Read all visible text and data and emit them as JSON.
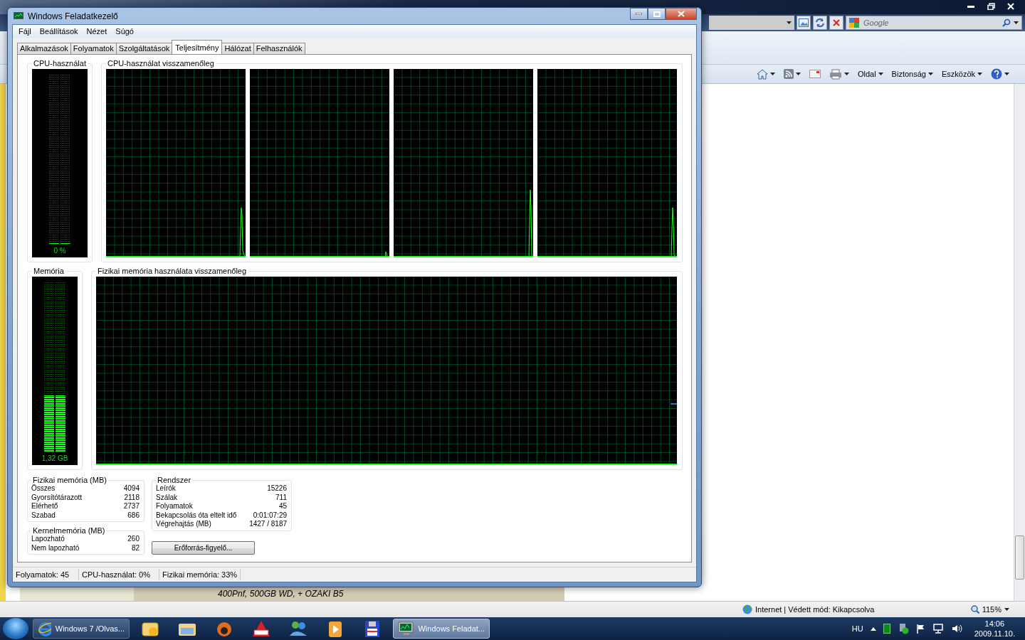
{
  "browser": {
    "search": {
      "placeholder": "Google"
    },
    "commands": [
      {
        "kind": "home"
      },
      {
        "kind": "feeds"
      },
      {
        "kind": "mail"
      },
      {
        "kind": "print"
      },
      {
        "kind": "menu",
        "label": "Oldal"
      },
      {
        "kind": "menu",
        "label": "Biztonság"
      },
      {
        "kind": "menu",
        "label": "Eszközök"
      },
      {
        "kind": "help"
      }
    ],
    "page_text": "400Pnf, 500GB WD, + OZAKI B5",
    "status": "Internet | Védett mód: Kikapcsolva",
    "zoom": "115%"
  },
  "task_manager": {
    "title": "Windows Feladatkezelő",
    "menu": [
      "Fájl",
      "Beállítások",
      "Nézet",
      "Súgó"
    ],
    "tabs": [
      {
        "label": "Alkalmazások",
        "selected": false
      },
      {
        "label": "Folyamatok",
        "selected": false
      },
      {
        "label": "Szolgáltatások",
        "selected": false
      },
      {
        "label": "Teljesítmény",
        "selected": true
      },
      {
        "label": "Hálózat",
        "selected": false
      },
      {
        "label": "Felhasználók",
        "selected": false
      }
    ],
    "cpu_meter": {
      "title": "CPU-használat",
      "reading": "0 %",
      "level": 0
    },
    "cpu_history": {
      "title": "CPU-használat visszamenőleg"
    },
    "memory_meter": {
      "title": "Memória",
      "reading": "1,32 GB",
      "level": 0.33
    },
    "memory_history": {
      "title": "Fizikai memória használata visszamenőleg"
    },
    "physical_memory": {
      "title": "Fizikai memória (MB)",
      "rows": [
        {
          "label": "Összes",
          "value": "4094"
        },
        {
          "label": "Gyorsítótárazott",
          "value": "2118"
        },
        {
          "label": "Elérhető",
          "value": "2737"
        },
        {
          "label": "Szabad",
          "value": "686"
        }
      ]
    },
    "kernel_memory": {
      "title": "Kernelmemória (MB)",
      "rows": [
        {
          "label": "Lapozható",
          "value": "260"
        },
        {
          "label": "Nem lapozható",
          "value": "82"
        }
      ]
    },
    "system": {
      "title": "Rendszer",
      "rows": [
        {
          "label": "Leírók",
          "value": "15226"
        },
        {
          "label": "Szálak",
          "value": "711"
        },
        {
          "label": "Folyamatok",
          "value": "45"
        },
        {
          "label": "Bekapcsolás óta eltelt idő",
          "value": "0:01:07:29"
        },
        {
          "label": "Végrehajtás (MB)",
          "value": "1427 / 8187"
        }
      ]
    },
    "monitor_button": "Erőforrás-figyelő...",
    "status_bar": [
      "Folyamatok: 45",
      "CPU-használat: 0%",
      "Fizikai memória: 33%"
    ]
  },
  "taskbar": {
    "items": [
      {
        "kind": "window",
        "label": "Windows 7 /Olvas...",
        "selected": false
      },
      {
        "kind": "pinned"
      },
      {
        "kind": "pinned"
      },
      {
        "kind": "pinned"
      },
      {
        "kind": "pinned"
      },
      {
        "kind": "pinned"
      },
      {
        "kind": "pinned"
      },
      {
        "kind": "pinned"
      },
      {
        "kind": "window",
        "label": "Windows Feladat...",
        "selected": true
      }
    ],
    "language": "HU",
    "time": "14:06",
    "date": "2009.11.10."
  }
}
